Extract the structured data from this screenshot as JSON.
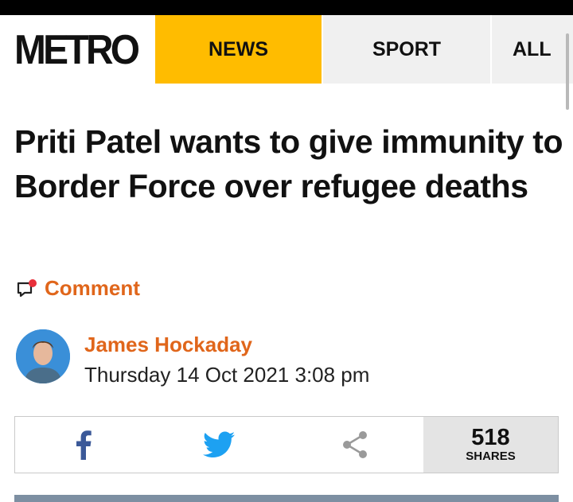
{
  "nav": {
    "logo": "METRO",
    "tabs": [
      {
        "label": "NEWS",
        "active": true
      },
      {
        "label": "SPORT",
        "active": false
      },
      {
        "label": "ALL",
        "active": false
      }
    ],
    "active_color": "#ffbc00"
  },
  "article": {
    "headline": "Priti Patel wants to give immunity to Border Force over refugee deaths",
    "comment_label": "Comment",
    "author": "James Hockaday",
    "published": "Thursday 14 Oct 2021 3:08 pm",
    "accent_color": "#e0661b"
  },
  "share": {
    "facebook_icon": "facebook-icon",
    "twitter_icon": "twitter-icon",
    "share_icon": "share-icon",
    "count": "518",
    "count_label": "SHARES"
  }
}
